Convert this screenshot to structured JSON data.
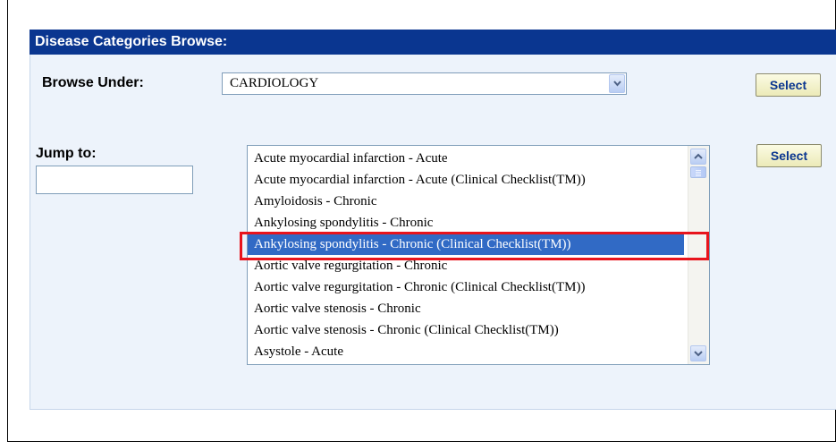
{
  "panel": {
    "title": "Disease Categories Browse:"
  },
  "browse": {
    "label": "Browse Under:",
    "selected_value": "CARDIOLOGY",
    "select_button_label": "Select"
  },
  "jump": {
    "label": "Jump to:",
    "input_value": "",
    "select_button_label": "Select"
  },
  "list": {
    "selected_index": 4,
    "items": [
      "Acute myocardial infarction - Acute",
      "Acute myocardial infarction - Acute (Clinical Checklist(TM))",
      "Amyloidosis - Chronic",
      "Ankylosing spondylitis - Chronic",
      "Ankylosing spondylitis - Chronic (Clinical Checklist(TM))",
      "Aortic valve regurgitation - Chronic",
      "Aortic valve regurgitation - Chronic (Clinical Checklist(TM))",
      "Aortic valve stenosis - Chronic",
      "Aortic valve stenosis - Chronic (Clinical Checklist(TM))",
      "Asystole - Acute"
    ]
  },
  "colors": {
    "header_bg": "#0a3690",
    "panel_bg": "#edf3fb",
    "selection_bg": "#316ac5",
    "highlight_border": "#e8141c",
    "button_text": "#0a3690"
  },
  "icons": {
    "dropdown": "chevron-down-icon",
    "scroll_up": "chevron-up-icon",
    "scroll_down": "chevron-down-icon"
  }
}
